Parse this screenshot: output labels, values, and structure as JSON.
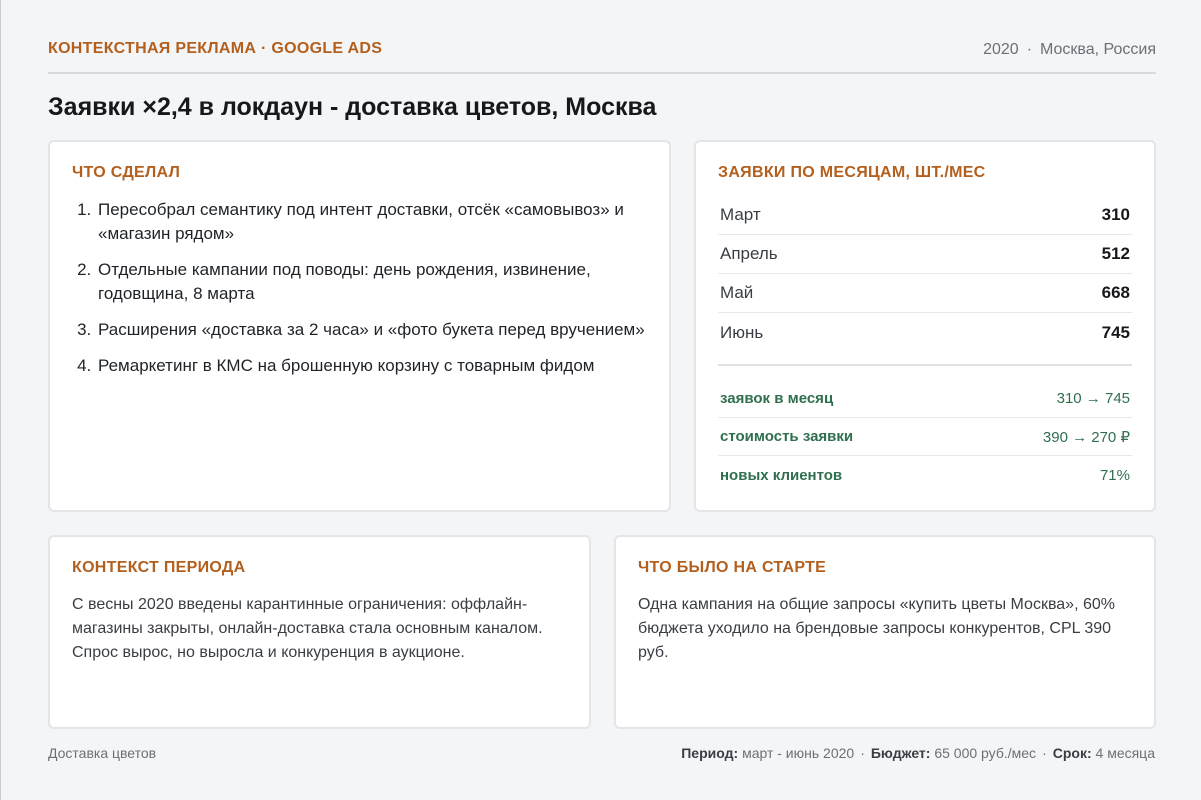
{
  "header": {
    "category": "КОНТЕКСТНАЯ РЕКЛАМА · GOOGLE ADS",
    "year": "2020",
    "separator": "·",
    "location": "Москва, Россия"
  },
  "title": "Заявки ×2,4 в локдаун - доставка цветов, Москва",
  "done": {
    "title": "ЧТО СДЕЛАЛ",
    "steps": [
      "Пересобрал семантику под интент доставки, отсёк «самовывоз» и «магазин рядом»",
      "Отдельные кампании под поводы: день рождения, извинение, годовщина, 8 марта",
      "Расширения «доставка за 2 часа» и «фото букета перед вручением»",
      "Ремаркетинг в КМС на брошенную корзину с товарным фидом"
    ]
  },
  "monthly": {
    "title": "ЗАЯВКИ ПО МЕСЯЦАМ, ШТ./МЕС",
    "rows": [
      {
        "month": "Март",
        "value": "310"
      },
      {
        "month": "Апрель",
        "value": "512"
      },
      {
        "month": "Май",
        "value": "668"
      },
      {
        "month": "Июнь",
        "value": "745"
      }
    ],
    "kpis": [
      {
        "label": "заявок в месяц",
        "value": "310 → 745"
      },
      {
        "label": "стоимость заявки",
        "value": "390 → 270 ₽"
      },
      {
        "label": "новых клиентов",
        "value": "71%"
      }
    ]
  },
  "context": {
    "title": "КОНТЕКСТ ПЕРИОДА",
    "text": "С весны 2020 введены карантинные ограничения: оффлайн-магазины закрыты, онлайн-доставка стала основным каналом. Спрос вырос, но выросла и конкуренция в аукционе."
  },
  "start": {
    "title": "ЧТО БЫЛО НА СТАРТЕ",
    "text": "Одна кампания на общие запросы «купить цветы Москва», 60% бюджета уходило на брендовые запросы конкурентов, CPL 390 руб."
  },
  "footer": {
    "left": "Доставка цветов",
    "separator": "·",
    "period_label": "Период:",
    "period_value": "март - июнь 2020",
    "budget_label": "Бюджет:",
    "budget_value": "65 000 руб./мес",
    "term_label": "Срок:",
    "term_value": "4 месяца"
  },
  "colors": {
    "accent": "#b35f1d",
    "kpi_green": "#2f6f4e",
    "background": "#f4f5f7",
    "card": "#ffffff"
  }
}
